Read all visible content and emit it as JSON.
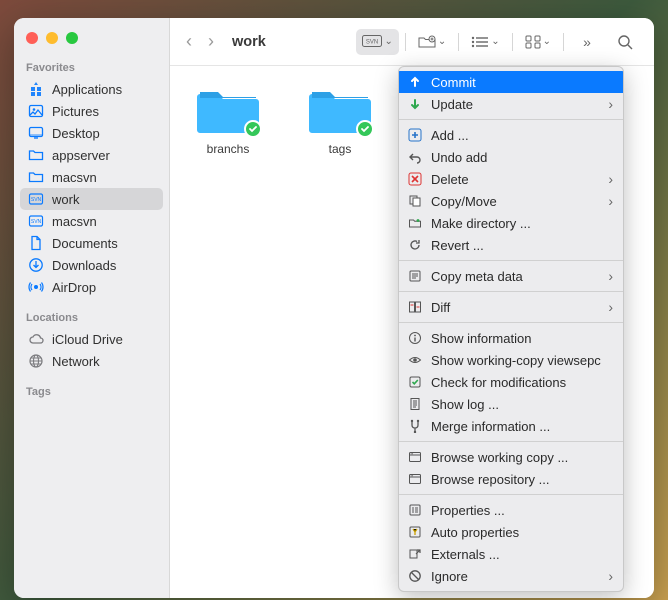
{
  "window": {
    "title": "work"
  },
  "sidebar": {
    "sections": [
      {
        "title": "Favorites",
        "items": [
          {
            "label": "Applications",
            "icon": "apps"
          },
          {
            "label": "Pictures",
            "icon": "pictures"
          },
          {
            "label": "Desktop",
            "icon": "desktop"
          },
          {
            "label": "appserver",
            "icon": "folder"
          },
          {
            "label": "macsvn",
            "icon": "folder"
          },
          {
            "label": "work",
            "icon": "svn",
            "selected": true
          },
          {
            "label": "macsvn",
            "icon": "svn"
          },
          {
            "label": "Documents",
            "icon": "doc"
          },
          {
            "label": "Downloads",
            "icon": "download"
          },
          {
            "label": "AirDrop",
            "icon": "airdrop"
          }
        ]
      },
      {
        "title": "Locations",
        "items": [
          {
            "label": "iCloud Drive",
            "icon": "cloud",
            "gray": true
          },
          {
            "label": "Network",
            "icon": "network",
            "gray": true
          }
        ]
      },
      {
        "title": "Tags",
        "items": []
      }
    ]
  },
  "toolbar": {
    "svn_label": "SVN"
  },
  "folders": [
    {
      "label": "branchs",
      "checked": true
    },
    {
      "label": "tags",
      "checked": true
    }
  ],
  "menu": {
    "groups": [
      [
        {
          "label": "Commit",
          "icon": "up-green",
          "highlighted": true
        },
        {
          "label": "Update",
          "icon": "down-green",
          "submenu": true
        }
      ],
      [
        {
          "label": "Add ...",
          "icon": "plus"
        },
        {
          "label": "Undo add",
          "icon": "undo"
        },
        {
          "label": "Delete",
          "icon": "delete",
          "submenu": true
        },
        {
          "label": "Copy/Move",
          "icon": "copy",
          "submenu": true
        },
        {
          "label": "Make directory ...",
          "icon": "mkdir"
        },
        {
          "label": "Revert ...",
          "icon": "revert"
        }
      ],
      [
        {
          "label": "Copy meta data",
          "icon": "meta",
          "submenu": true
        }
      ],
      [
        {
          "label": "Diff",
          "icon": "diff",
          "submenu": true
        }
      ],
      [
        {
          "label": "Show information",
          "icon": "info"
        },
        {
          "label": "Show working-copy viewsepc",
          "icon": "eye"
        },
        {
          "label": "Check for modifications",
          "icon": "check"
        },
        {
          "label": "Show log ...",
          "icon": "log"
        },
        {
          "label": "Merge information ...",
          "icon": "merge"
        }
      ],
      [
        {
          "label": "Browse working copy ...",
          "icon": "browse"
        },
        {
          "label": "Browse repository ...",
          "icon": "browse"
        }
      ],
      [
        {
          "label": "Properties ...",
          "icon": "props"
        },
        {
          "label": "Auto properties",
          "icon": "autoprops"
        },
        {
          "label": "Externals ...",
          "icon": "ext"
        },
        {
          "label": "Ignore",
          "icon": "ignore",
          "submenu": true
        }
      ]
    ]
  }
}
